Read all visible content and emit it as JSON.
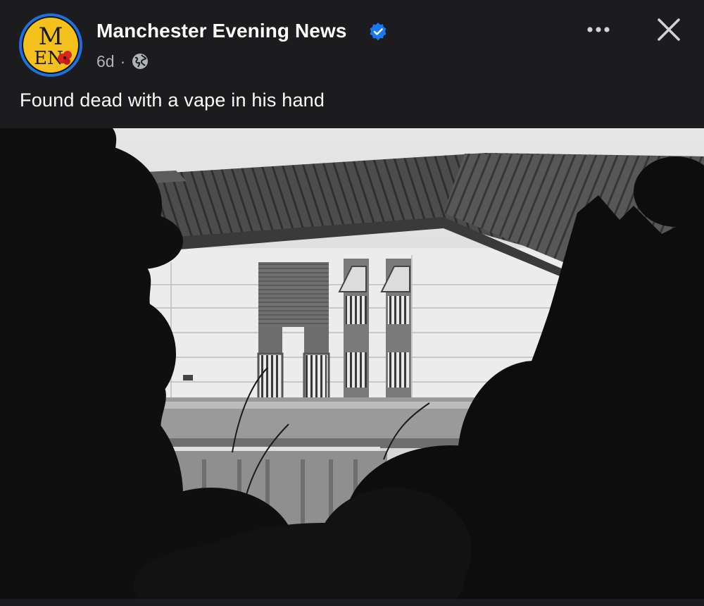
{
  "post": {
    "page_name": "Manchester Evening News",
    "timestamp": "6d",
    "separator": "·",
    "privacy_icon": "globe-icon",
    "caption": "Found dead with a vape in his hand",
    "verified_icon": "verified-badge-icon"
  },
  "avatar": {
    "logo_text_top": "M",
    "logo_text_bottom": "EN",
    "colors": {
      "ring": "#1e6fe0",
      "background": "#f3c01c"
    }
  },
  "actions": {
    "more_icon": "more-dots-icon",
    "close_icon": "close-icon"
  },
  "image": {
    "description_icon": "photo",
    "tone": "black-and-white"
  },
  "colors": {
    "background": "#1c1c1e",
    "text_primary": "#ffffff",
    "text_secondary": "#b0b3b8",
    "verified_blue": "#1877f2"
  }
}
